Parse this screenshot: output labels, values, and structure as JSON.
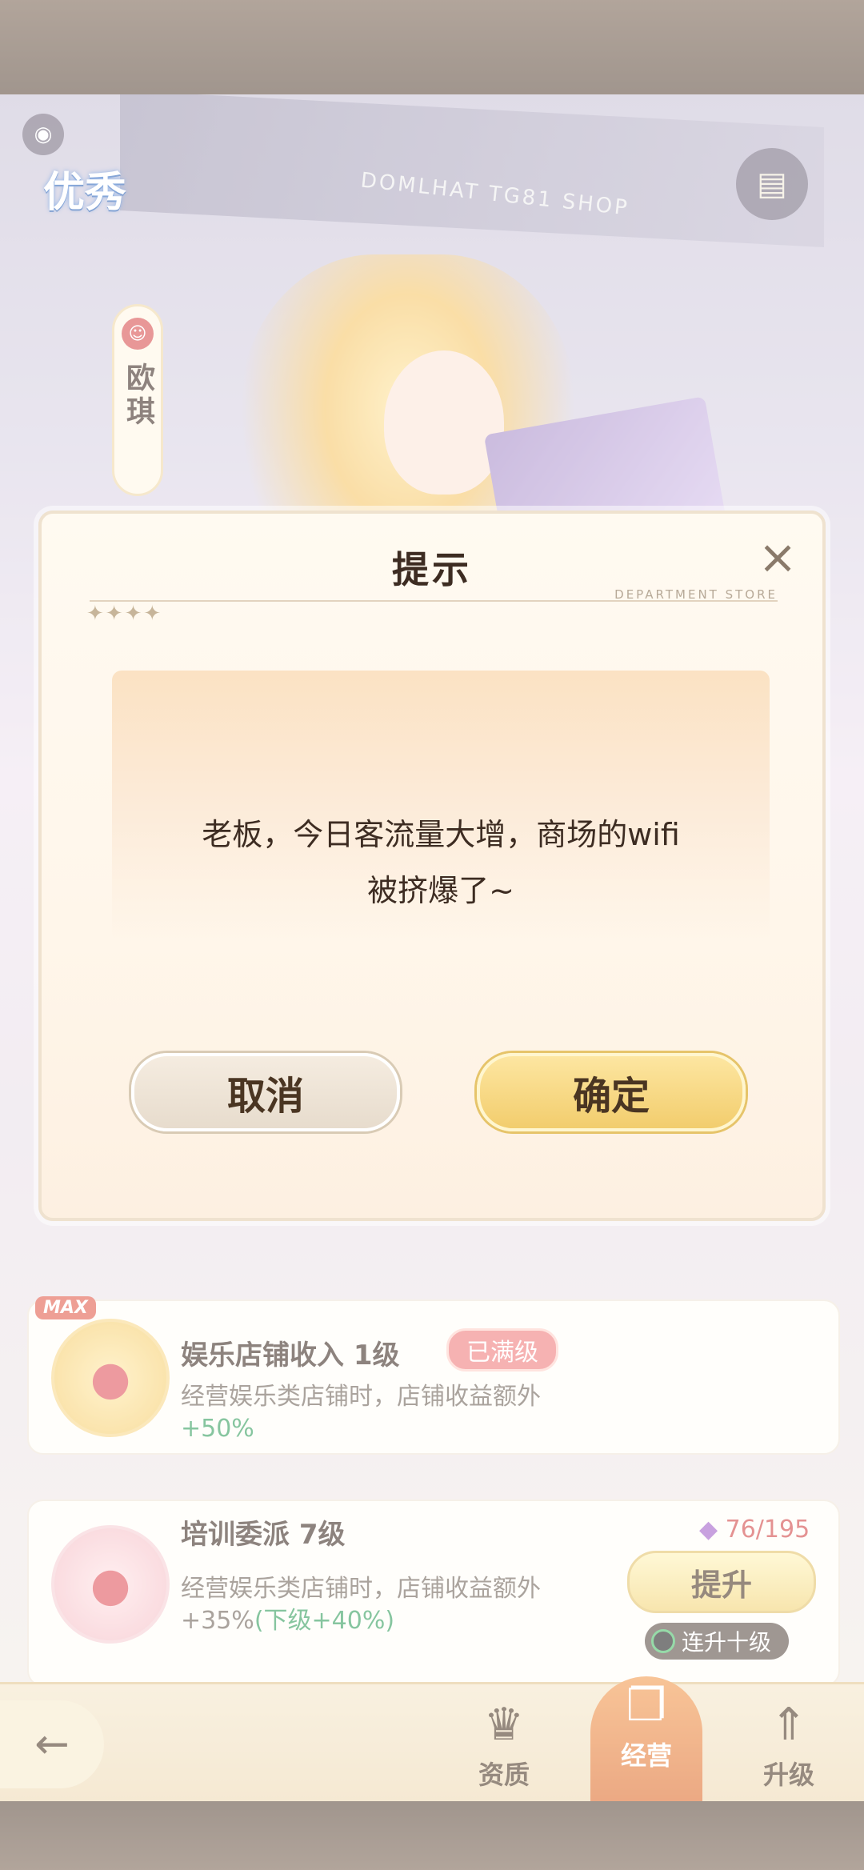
{
  "hud": {
    "rank_label": "优秀",
    "character_name": "欧琪",
    "shop_sign_text": "DOMLHAT TG81 SHOP"
  },
  "skills": [
    {
      "title": "娱乐店铺收入 1级",
      "badge": "已满级",
      "max_tag": "MAX",
      "desc": "经营娱乐类店铺时，店铺收益额外",
      "bonus": "+50%"
    },
    {
      "title": "培训委派 7级",
      "desc": "经营娱乐类店铺时，店铺收益额外",
      "bonus": "+35%",
      "next_bonus": "(下级+40%)",
      "cost": "76/195",
      "upgrade_label": "提升",
      "auto_label": "连升十级"
    }
  ],
  "nav": {
    "tabs": [
      {
        "label": "资质",
        "icon": "crown-icon"
      },
      {
        "label": "经营",
        "icon": "book-icon"
      },
      {
        "label": "升级",
        "icon": "upgrade-arrow-icon"
      }
    ],
    "active": "经营"
  },
  "dialog": {
    "title": "提示",
    "subtitle": "DEPARTMENT STORE",
    "message_line1": "老板，今日客流量大增，商场的wifi",
    "message_line2": "被挤爆了~",
    "cancel_label": "取消",
    "confirm_label": "确定"
  },
  "colors": {
    "accent": "#f2cd6d",
    "nav_active": "#dd6a2a",
    "cost_red": "#d14444",
    "bonus_green": "#2f9c5a"
  }
}
